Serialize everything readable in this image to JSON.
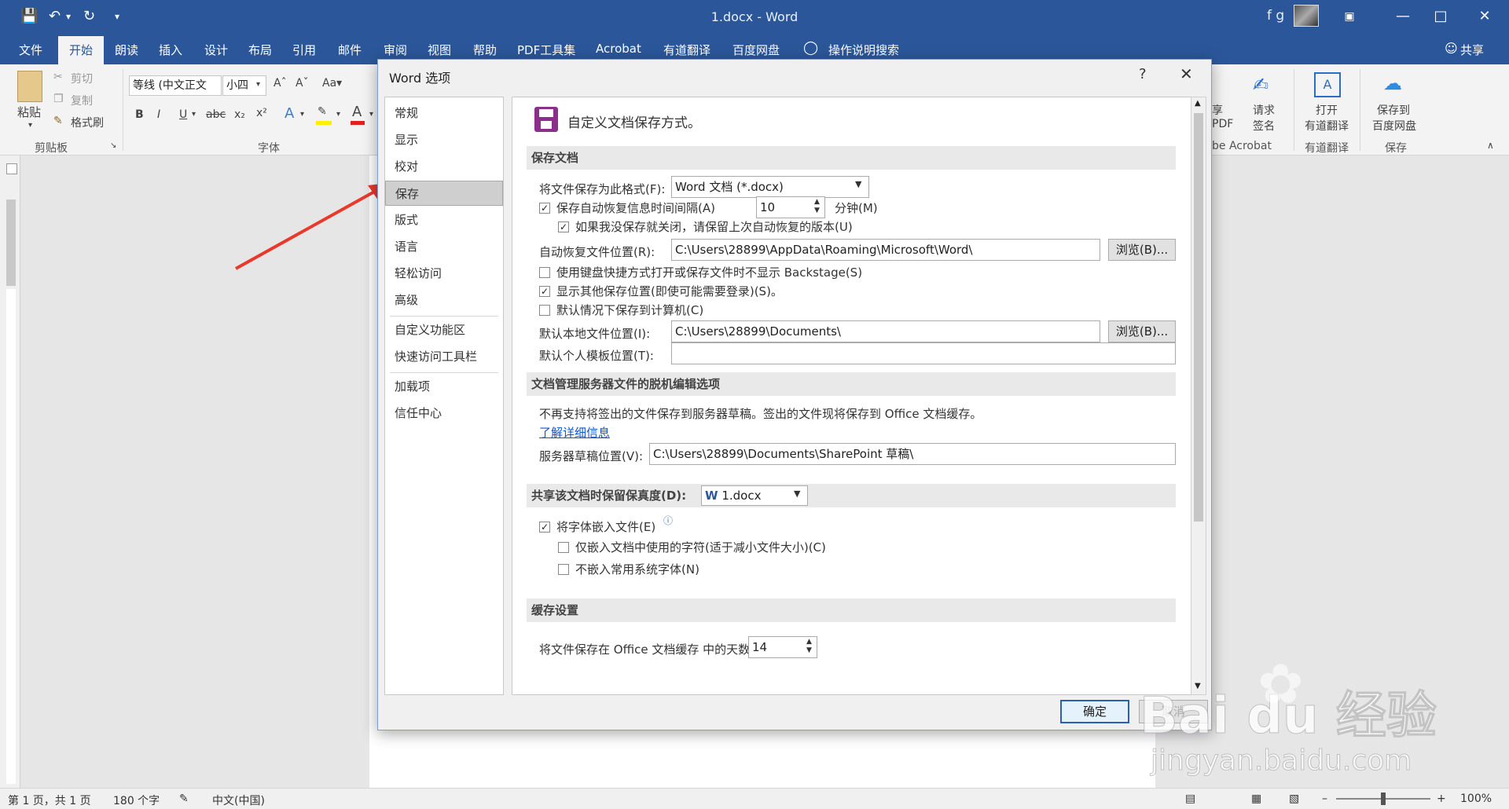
{
  "titlebar": {
    "doc_title": "1.docx  -  Word",
    "user_initials": "f g"
  },
  "tabs": [
    "文件",
    "开始",
    "朗读",
    "插入",
    "设计",
    "布局",
    "引用",
    "邮件",
    "审阅",
    "视图",
    "帮助",
    "PDF工具集",
    "Acrobat",
    "有道翻译",
    "百度网盘",
    "操作说明搜索"
  ],
  "share_label": "共享",
  "ribbon": {
    "clipboard": {
      "paste": "粘贴",
      "cut": "剪切",
      "copy": "复制",
      "format_painter": "格式刷",
      "group": "剪贴板"
    },
    "font": {
      "font_name": "等线 (中文正文",
      "font_size": "小四",
      "group": "字体"
    },
    "right": {
      "share_pdf_1": "享",
      "share_pdf_2": "PDF",
      "request_1": "请求",
      "request_2": "签名",
      "acrobat_group": "be Acrobat",
      "youdao_1": "打开",
      "youdao_2": "有道翻译",
      "youdao_group": "有道翻译",
      "baidu_1": "保存到",
      "baidu_2": "百度网盘",
      "baidu_group": "保存"
    }
  },
  "dialog": {
    "title": "Word 选项",
    "help": "?",
    "nav": [
      "常规",
      "显示",
      "校对",
      "保存",
      "版式",
      "语言",
      "轻松访问",
      "高级",
      "自定义功能区",
      "快速访问工具栏",
      "加载项",
      "信任中心"
    ],
    "selected_nav": "保存",
    "header": "自定义文档保存方式。",
    "sections": {
      "save": "保存文档",
      "server": "文档管理服务器文件的脱机编辑选项",
      "fidelity": "共享该文档时保留保真度(D):",
      "cache": "缓存设置"
    },
    "save_format_label": "将文件保存为此格式(F):",
    "save_format_value": "Word 文档 (*.docx)",
    "autorecover_label": "保存自动恢复信息时间间隔(A)",
    "autorecover_minutes": "10",
    "minutes_label": "分钟(M)",
    "keep_last_label": "如果我没保存就关闭，请保留上次自动恢复的版本(U)",
    "autorecover_loc_label": "自动恢复文件位置(R):",
    "autorecover_loc_value": "C:\\Users\\28899\\AppData\\Roaming\\Microsoft\\Word\\",
    "browse_label": "浏览(B)...",
    "no_backstage_label": "使用键盘快捷方式打开或保存文件时不显示 Backstage(S)",
    "show_other_label": "显示其他保存位置(即使可能需要登录)(S)。",
    "save_to_computer_label": "默认情况下保存到计算机(C)",
    "default_local_label": "默认本地文件位置(I):",
    "default_local_value": "C:\\Users\\28899\\Documents\\",
    "default_template_label": "默认个人模板位置(T):",
    "default_template_value": "",
    "server_note": "不再支持将签出的文件保存到服务器草稿。签出的文件现将保存到 Office 文档缓存。",
    "learn_more": "了解详细信息",
    "server_drafts_label": "服务器草稿位置(V):",
    "server_drafts_value": "C:\\Users\\28899\\Documents\\SharePoint 草稿\\",
    "fidelity_doc": "1.docx",
    "embed_fonts_label": "将字体嵌入文件(E)",
    "embed_chars_label": "仅嵌入文档中使用的字符(适于减小文件大小)(C)",
    "no_common_fonts_label": "不嵌入常用系统字体(N)",
    "cache_days_label": "将文件保存在 Office 文档缓存 中的天数:",
    "cache_days_value": "14",
    "ok": "确定",
    "cancel": "取消"
  },
  "statusbar": {
    "page": "第 1 页，共 1 页",
    "words": "180 个字",
    "lang": "中文(中国)",
    "zoom": "100%"
  },
  "watermark": {
    "brand": "Bai du 经验",
    "url": "jingyan.baidu.com"
  },
  "colors": {
    "title_blue": "#2b579a",
    "arrow_red": "#e8392b"
  }
}
